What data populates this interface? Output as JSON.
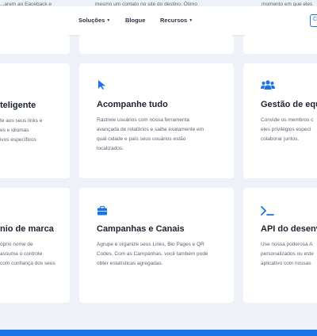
{
  "header": {
    "peek_left": "...arem ao Eaceback e",
    "peek_mid": "mesmo um contato no site do destino. Ótimo",
    "peek_right": "momento em que eles",
    "nav": [
      {
        "label": "Soluções",
        "has_caret": true
      },
      {
        "label": "Blogue",
        "has_caret": false
      },
      {
        "label": "Recursos",
        "has_caret": true
      }
    ],
    "edge_button_label": "C"
  },
  "cards_row1": [
    {
      "icon": "partial",
      "title": "teligente",
      "desc": "te aos seus links e\nes e idiomas\nivos específicos"
    },
    {
      "icon": "cursor-icon",
      "title": "Acompanhe tudo",
      "desc": "Rastreie usuários com nossa ferramenta\navançada de relatórios e saiba exatamente em\nqual cidade e país seus usuários estão\nlocalizados."
    },
    {
      "icon": "users-icon",
      "title": "Gestão de equ",
      "desc": "Convide os membros c\neles privilégios especí\ncolaborar juntos."
    }
  ],
  "cards_row2": [
    {
      "icon": "partial",
      "title": "nio de marca",
      "desc": "óprio nome de\n assuma o controle\ncom confiança dos seus"
    },
    {
      "icon": "briefcase-icon",
      "title": "Campanhas e Canais",
      "desc": "Agrupe e organize seus Links, Bio Pages e QR\nCodes. Com as Campanhas, você também pode\nobter estatísticas agregadas."
    },
    {
      "icon": "terminal-icon",
      "title": "API do desenv",
      "desc": "Use nossa poderosa A\npersonalizados ou este\naplicativo com nossas"
    }
  ],
  "colors": {
    "accent": "#1a73e8",
    "background": "#eef2f8",
    "card": "#ffffff"
  }
}
